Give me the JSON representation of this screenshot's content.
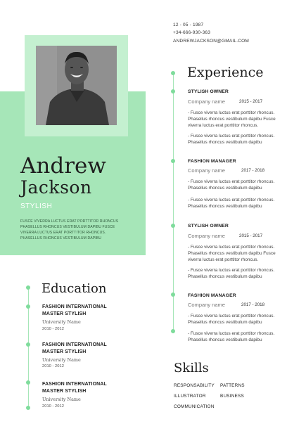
{
  "contact": {
    "date": "12 - 05 - 1987",
    "phone": "+34-666-930-363",
    "email": "ANDREWJACKSON@GMAIL.COM"
  },
  "profile": {
    "first_name": "Andrew",
    "last_name": "Jackson",
    "role": "STYLISH",
    "summary": "FUSCE VIVERRA LUCTUS ERAT PORTTITOR RHONCUS PHASELLUS RHONCUS VESTIBULUM DAPIBU FUSCE VIVERRA LUCTUS ERAT PORTTITOR RHONCUS. PHASELLUS RHONCUS VESTIBULUM DAPIBU"
  },
  "experience": {
    "title": "Experience",
    "jobs": [
      {
        "position": "STYLISH OWNER",
        "company": "Company name",
        "years": "2015 - 2017",
        "bullets": [
          "- Fusce viverra luctus erat porttitor rhoncus. Phasellus rhoncus vestibulum dapibu Fusce viverra luctus erat porttitor rhoncus.",
          "- Fusce viverra luctus erat porttitor rhoncus. Phasellus rhoncus vestibulum dapibu"
        ]
      },
      {
        "position": "FASHION MANAGER",
        "company": "Company name",
        "years": "2017 - 2018",
        "bullets": [
          "- Fusce viverra luctus erat porttitor rhoncus. Phasellus rhoncus vestibulum dapibu",
          "- Fusce viverra luctus erat porttitor rhoncus. Phasellus rhoncus vestibulum dapibu"
        ]
      },
      {
        "position": "STYLISH OWNER",
        "company": "Company name",
        "years": "2015 - 2017",
        "bullets": [
          "- Fusce viverra luctus erat porttitor rhoncus. Phasellus rhoncus vestibulum dapibu Fusce viverra luctus erat porttitor rhoncus.",
          "- Fusce viverra luctus erat porttitor rhoncus. Phasellus rhoncus vestibulum dapibu"
        ]
      },
      {
        "position": "FASHION MANAGER",
        "company": "Company name",
        "years": "2017 - 2018",
        "bullets": [
          "- Fusce viverra luctus erat porttitor rhoncus. Phasellus rhoncus vestibulum dapibu",
          "- Fusce viverra luctus erat porttitor rhoncus. Phasellus rhoncus vestibulum dapibu"
        ]
      }
    ]
  },
  "education": {
    "title": "Education",
    "items": [
      {
        "line1": "FASHION INTERNATIONAL",
        "line2": "MASTER STYLISH",
        "university": "University Name",
        "years": "2010 - 2012"
      },
      {
        "line1": "FASHION INTERNATIONAL",
        "line2": "MASTER STYLISH",
        "university": "University Name",
        "years": "2010 - 2012"
      },
      {
        "line1": "FASHION INTERNATIONAL",
        "line2": "MASTER STYLISH",
        "university": "University Name",
        "years": "2010 - 2012"
      }
    ]
  },
  "skills": {
    "title": "Skills",
    "items": [
      "RESPONSABILITY",
      "PATTERNS",
      "ILLUSTRATOR",
      "BUSINESS",
      "COMMUNICATION"
    ]
  },
  "colors": {
    "accent_green": "#a6e6b8",
    "frame_green": "#c4f0d0",
    "dot_green": "#7fdc9c",
    "text_dark": "#1e1e1e"
  }
}
